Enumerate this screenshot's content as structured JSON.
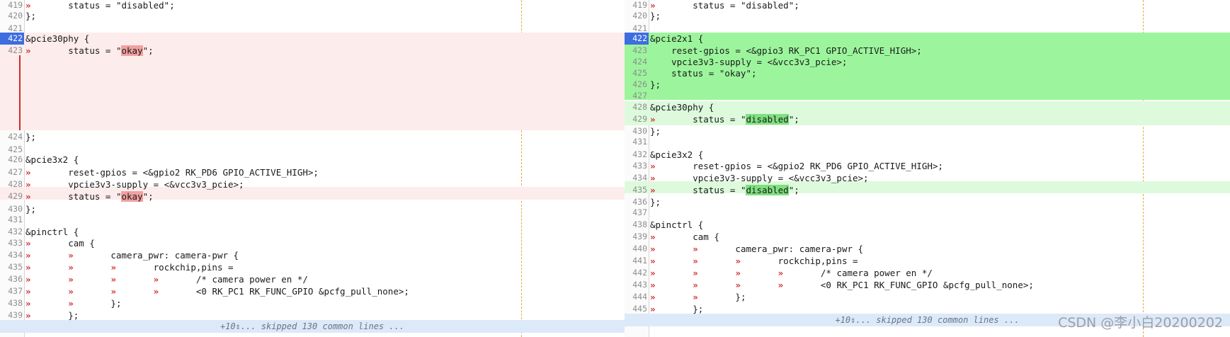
{
  "left": {
    "lines": [
      {
        "n": "419",
        "t": "→       status = \"disabled\";"
      },
      {
        "n": "420",
        "t": "};"
      },
      {
        "n": "421",
        "t": ""
      },
      {
        "n": "422",
        "t": "&pcie30phy {",
        "active": true
      },
      {
        "n": "423",
        "t": "→       status = \"okay\";"
      },
      {
        "n": "424",
        "t": "};"
      },
      {
        "n": "425",
        "t": ""
      },
      {
        "n": "426",
        "t": "&pcie3x2 {"
      },
      {
        "n": "427",
        "t": "→       reset-gpios = <&gpio2 RK_PD6 GPIO_ACTIVE_HIGH>;"
      },
      {
        "n": "428",
        "t": "→       vpcie3v3-supply = <&vcc3v3_pcie>;"
      },
      {
        "n": "429",
        "t": "→       status = \"okay\";"
      },
      {
        "n": "430",
        "t": "};"
      },
      {
        "n": "431",
        "t": ""
      },
      {
        "n": "432",
        "t": "&pinctrl {"
      },
      {
        "n": "433",
        "t": "→       cam {"
      },
      {
        "n": "434",
        "t": "→       →       camera_pwr: camera-pwr {"
      },
      {
        "n": "435",
        "t": "→       →       →       rockchip,pins ="
      },
      {
        "n": "436",
        "t": "→       →       →       →       /* camera power en */"
      },
      {
        "n": "437",
        "t": "→       →       →       →       <0 RK_PC1 RK_FUNC_GPIO &pcfg_pull_none>;"
      },
      {
        "n": "438",
        "t": "→       →       };"
      },
      {
        "n": "439",
        "t": "→       };"
      }
    ],
    "skip": "+10⇕... skipped 130 common lines ..."
  },
  "right": {
    "lines": [
      {
        "n": "419",
        "t": "→       status = \"disabled\";"
      },
      {
        "n": "420",
        "t": "};"
      },
      {
        "n": "421",
        "t": ""
      },
      {
        "n": "422",
        "t": "&pcie2x1 {",
        "active": true
      },
      {
        "n": "423",
        "t": "    reset-gpios = <&gpio3 RK_PC1 GPIO_ACTIVE_HIGH>;"
      },
      {
        "n": "424",
        "t": "    vpcie3v3-supply = <&vcc3v3_pcie>;"
      },
      {
        "n": "425",
        "t": "    status = \"okay\";"
      },
      {
        "n": "426",
        "t": "};"
      },
      {
        "n": "427",
        "t": ""
      },
      {
        "n": "428",
        "t": "&pcie30phy {"
      },
      {
        "n": "429",
        "t": "→       status = \"disabled\";"
      },
      {
        "n": "430",
        "t": "};"
      },
      {
        "n": "431",
        "t": ""
      },
      {
        "n": "432",
        "t": "&pcie3x2 {"
      },
      {
        "n": "433",
        "t": "→       reset-gpios = <&gpio2 RK_PD6 GPIO_ACTIVE_HIGH>;"
      },
      {
        "n": "434",
        "t": "→       vpcie3v3-supply = <&vcc3v3_pcie>;"
      },
      {
        "n": "435",
        "t": "→       status = \"disabled\";"
      },
      {
        "n": "436",
        "t": "};"
      },
      {
        "n": "437",
        "t": ""
      },
      {
        "n": "438",
        "t": "&pinctrl {"
      },
      {
        "n": "439",
        "t": "→       cam {"
      },
      {
        "n": "440",
        "t": "→       →       camera_pwr: camera-pwr {"
      },
      {
        "n": "441",
        "t": "→       →       →       rockchip,pins ="
      },
      {
        "n": "442",
        "t": "→       →       →       →       /* camera power en */"
      },
      {
        "n": "443",
        "t": "→       →       →       →       <0 RK_PC1 RK_FUNC_GPIO &pcfg_pull_none>;"
      },
      {
        "n": "444",
        "t": "→       →       };"
      },
      {
        "n": "445",
        "t": "→       };"
      }
    ],
    "skip": "+10⇕... skipped 130 common lines ..."
  },
  "watermark": "CSDN @李小白20200202",
  "colors": {
    "deleted_bg": "#fdecec",
    "deleted_word": "#f2a0a0",
    "added_bg": "#9cf59c",
    "changed_bg": "#ddfadd",
    "added_word": "#7fe07f",
    "tab_arrow": "#d12a2a",
    "active_line": "#3d6de0",
    "skip_bar": "#dce9f8"
  }
}
